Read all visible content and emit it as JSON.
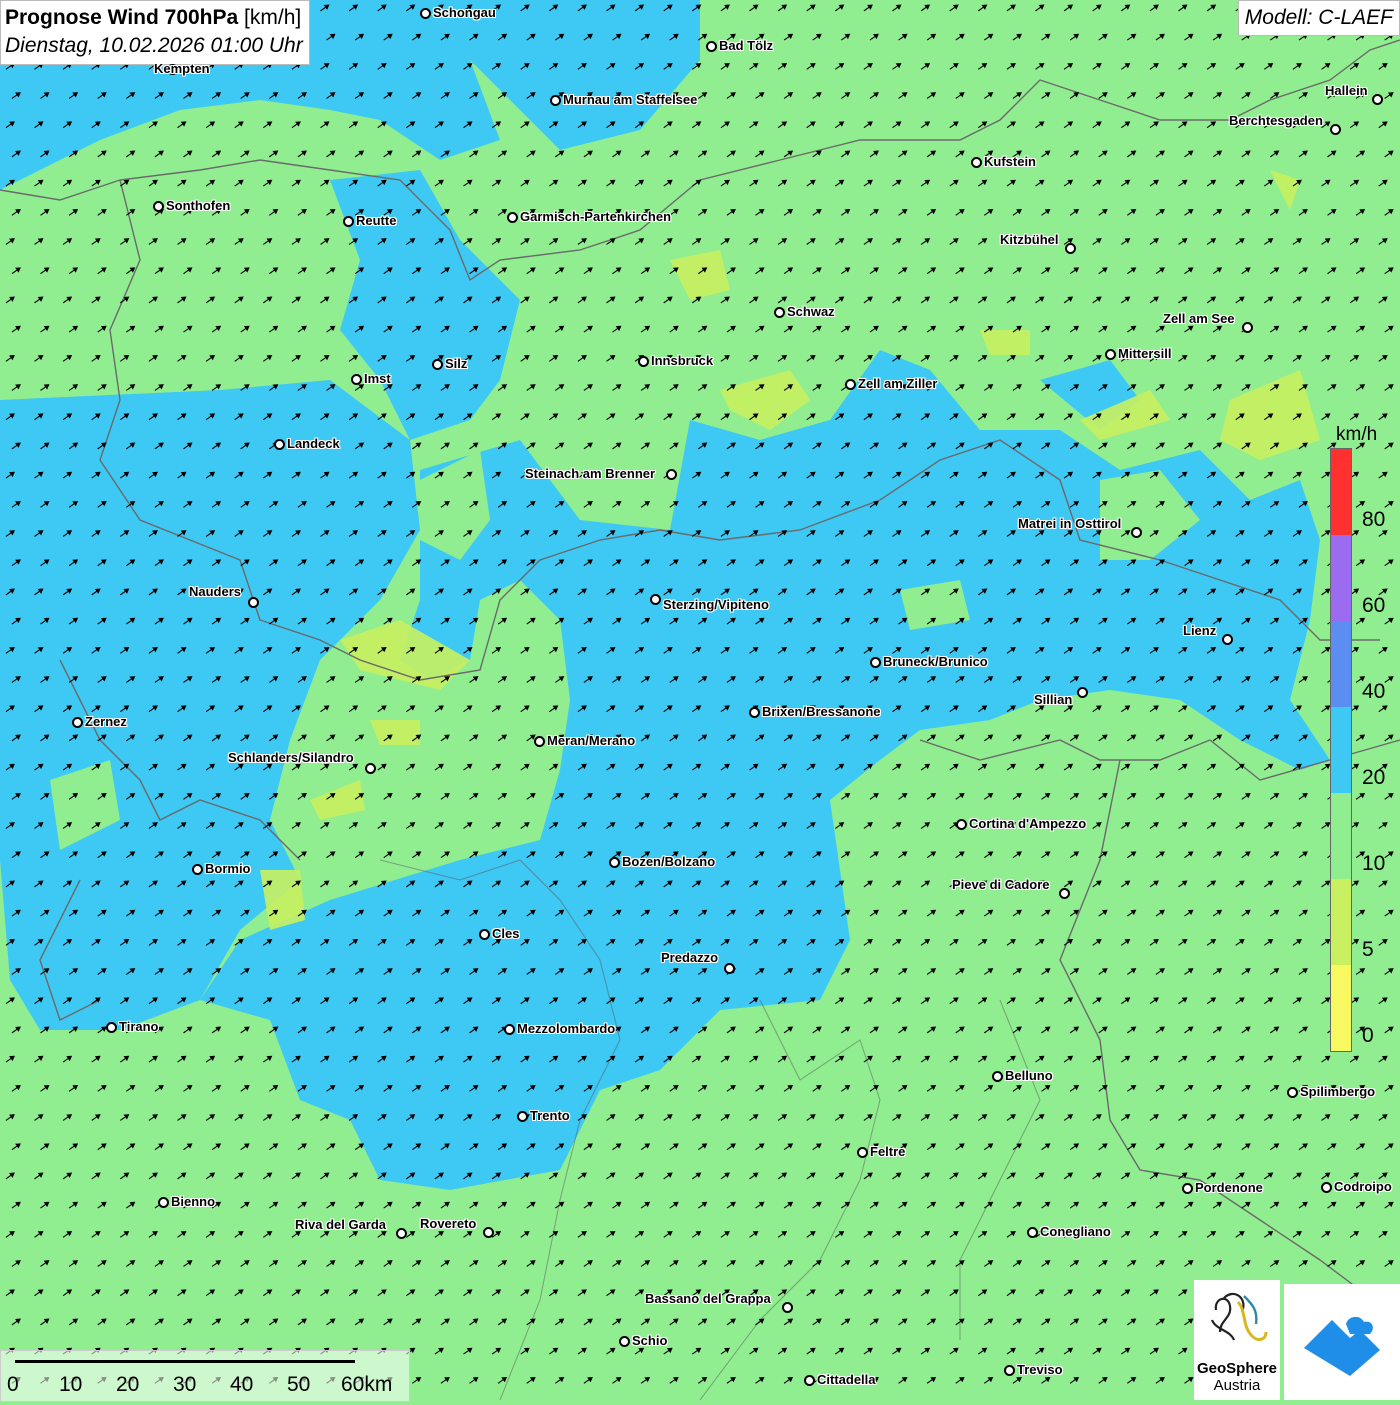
{
  "header": {
    "title_bold": "Prognose Wind 700hPa",
    "title_unit": " [km/h]",
    "date": "Dienstag, 10.02.2026 01:00 Uhr"
  },
  "model": "Modell: C-LAEF",
  "legend": {
    "unit": "km/h",
    "levels": [
      "80",
      "60",
      "40",
      "20",
      "10",
      "5",
      "0"
    ],
    "colors": [
      "#ff3030",
      "#f4dcf4",
      "#9b6cf0",
      "#5b8ef0",
      "#3ec8f4",
      "#90ee90",
      "#c8f060",
      "#f8f860"
    ]
  },
  "cities": [
    {
      "name": "Schongau"
    },
    {
      "name": "Bad Tölz"
    },
    {
      "name": "Kempten"
    },
    {
      "name": "Murnau am Staffelsee"
    },
    {
      "name": "Hallein"
    },
    {
      "name": "Berchtesgaden"
    },
    {
      "name": "Kufstein"
    },
    {
      "name": "Sonthofen"
    },
    {
      "name": "Reutte"
    },
    {
      "name": "Garmisch-Partenkirchen"
    },
    {
      "name": "Kitzbühel"
    },
    {
      "name": "Schwaz"
    },
    {
      "name": "Zell am See"
    },
    {
      "name": "Mittersill"
    },
    {
      "name": "Imst"
    },
    {
      "name": "Silz"
    },
    {
      "name": "Innsbruck"
    },
    {
      "name": "Zell am Ziller"
    },
    {
      "name": "Landeck"
    },
    {
      "name": "Steinach am Brenner"
    },
    {
      "name": "Matrei in Osttirol"
    },
    {
      "name": "Nauders"
    },
    {
      "name": "Sterzing/Vipiteno"
    },
    {
      "name": "Lienz"
    },
    {
      "name": "Bruneck/Brunico"
    },
    {
      "name": "Sillian"
    },
    {
      "name": "Zernez"
    },
    {
      "name": "Brixen/Bressanone"
    },
    {
      "name": "Meran/Merano"
    },
    {
      "name": "Schlanders/Silandro"
    },
    {
      "name": "Cortina d'Ampezzo"
    },
    {
      "name": "Bozen/Bolzano"
    },
    {
      "name": "Bormio"
    },
    {
      "name": "Pieve di Cadore"
    },
    {
      "name": "Cles"
    },
    {
      "name": "Predazzo"
    },
    {
      "name": "Tirano"
    },
    {
      "name": "Mezzolombardo"
    },
    {
      "name": "Belluno"
    },
    {
      "name": "Spilimbergo"
    },
    {
      "name": "Trento"
    },
    {
      "name": "Feltre"
    },
    {
      "name": "Pordenone"
    },
    {
      "name": "Codroipo"
    },
    {
      "name": "Bienno"
    },
    {
      "name": "Riva del Garda"
    },
    {
      "name": "Rovereto"
    },
    {
      "name": "Conegliano"
    },
    {
      "name": "Bassano del Grappa"
    },
    {
      "name": "Schio"
    },
    {
      "name": "Treviso"
    },
    {
      "name": "Cittadella"
    }
  ],
  "scale": {
    "labels": [
      "0",
      "10",
      "20",
      "30",
      "40",
      "50",
      "60km"
    ]
  },
  "logos": {
    "geosphere_line1": "GeoSphere",
    "geosphere_line2": "Austria"
  },
  "wind": {
    "arrow_direction": "north-east"
  }
}
